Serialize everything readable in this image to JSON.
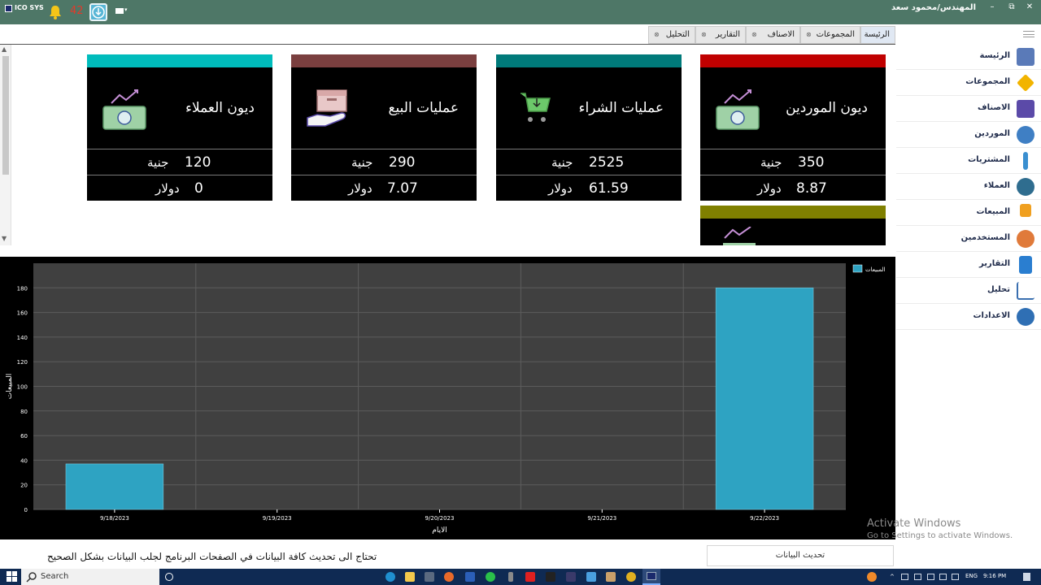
{
  "app": {
    "name": "ICO SYS",
    "notification_count": "42",
    "user": "المهندس/محمود سعد"
  },
  "window_controls": {
    "minimize": "–",
    "restore": "⧉",
    "close": "✕"
  },
  "tabs": [
    {
      "label": "الرئيسة",
      "closable": false
    },
    {
      "label": "المجموعات",
      "closable": true
    },
    {
      "label": "الاصناف",
      "closable": true
    },
    {
      "label": "التقارير",
      "closable": true
    },
    {
      "label": "التحليل",
      "closable": true
    }
  ],
  "sidebar": {
    "items": [
      {
        "label": "الرئيسة",
        "icon": "home-icon",
        "color": "#5a7ab8"
      },
      {
        "label": "المجموعات",
        "icon": "groups-icon",
        "color": "#f2b400"
      },
      {
        "label": "الاصناف",
        "icon": "items-icon",
        "color": "#5b4aa8"
      },
      {
        "label": "الموردين",
        "icon": "suppliers-icon",
        "color": "#3f7fc4"
      },
      {
        "label": "المشتريات",
        "icon": "purchases-icon",
        "color": "#3a8fd0"
      },
      {
        "label": "العملاء",
        "icon": "customers-icon",
        "color": "#2f6d8f"
      },
      {
        "label": "المبيعات",
        "icon": "sales-icon",
        "color": "#f0a020"
      },
      {
        "label": "المستخدمين",
        "icon": "users-icon",
        "color": "#e07a3a"
      },
      {
        "label": "التقارير",
        "icon": "reports-icon",
        "color": "#2a7ed0"
      },
      {
        "label": "تحليل",
        "icon": "analysis-icon",
        "color": "#3a6fb0"
      },
      {
        "label": "الاعدادات",
        "icon": "settings-icon",
        "color": "#2f6fb4"
      }
    ]
  },
  "cards": [
    {
      "title": "ديون الموردين",
      "strip_color": "#c00000",
      "icon": "money-trend-icon",
      "egp_value": "350",
      "egp_unit": "جنية",
      "usd_value": "8.87",
      "usd_unit": "دولار"
    },
    {
      "title": "عمليات الشراء",
      "strip_color": "#007a7a",
      "icon": "cart-icon",
      "egp_value": "2525",
      "egp_unit": "جنية",
      "usd_value": "61.59",
      "usd_unit": "دولار"
    },
    {
      "title": "عمليات البيع",
      "strip_color": "#7a3f3f",
      "icon": "box-hand-icon",
      "egp_value": "290",
      "egp_unit": "جنية",
      "usd_value": "7.07",
      "usd_unit": "دولار"
    },
    {
      "title": "ديون العملاء",
      "strip_color": "#00bcbc",
      "icon": "money-trend-icon",
      "egp_value": "120",
      "egp_unit": "جنية",
      "usd_value": "0",
      "usd_unit": "دولار"
    }
  ],
  "partial_card": {
    "strip_color": "#808000",
    "icon": "money-trend-icon"
  },
  "chart_data": {
    "type": "bar",
    "categories": [
      "9/18/2023",
      "9/19/2023",
      "9/20/2023",
      "9/21/2023",
      "9/22/2023"
    ],
    "series": [
      {
        "name": "المبيعات",
        "values": [
          37,
          0,
          0,
          0,
          180
        ],
        "color": "#2ea3c2"
      }
    ],
    "xlabel": "الايام",
    "ylabel": "المبيعات",
    "ylim": [
      0,
      200
    ],
    "yticks": [
      0,
      20,
      40,
      60,
      80,
      100,
      120,
      140,
      160,
      180
    ],
    "grid": true,
    "legend": "top-right",
    "plot_background": "#404040",
    "panel_background": "#000000"
  },
  "bottom": {
    "refresh_label": "تحديث البيانات",
    "note": "تحتاج الى تحديث كافة البيانات في الصفحات البرنامج لجلب البيانات بشكل الصحيح"
  },
  "watermark": {
    "title": "Activate Windows",
    "subtitle": "Go to Settings to activate Windows."
  },
  "taskbar": {
    "search_placeholder": "Search",
    "language": "ENG",
    "time": "9:16 PM"
  }
}
